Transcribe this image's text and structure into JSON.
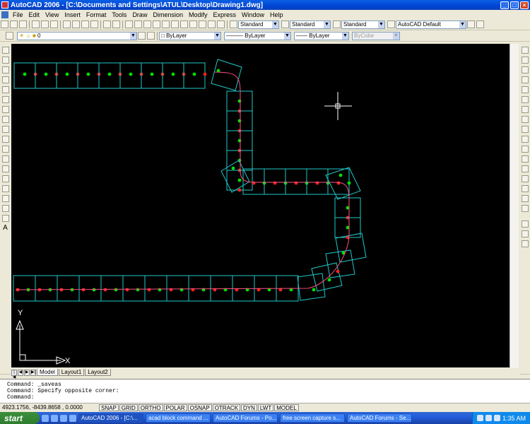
{
  "window": {
    "title": "AutoCAD 2006 - [C:\\Documents and Settings\\ATUL\\Desktop\\Drawing1.dwg]"
  },
  "menu": [
    "File",
    "Edit",
    "View",
    "Insert",
    "Format",
    "Tools",
    "Draw",
    "Dimension",
    "Modify",
    "Express",
    "Window",
    "Help"
  ],
  "toolbar": {
    "text_style": "Standard",
    "dim_style": "Standard",
    "table_style": "Standard",
    "plot_style": "AutoCAD Default",
    "layer": "0",
    "color": "ByLayer",
    "linetype": "ByLayer",
    "lineweight": "ByLayer",
    "plotstyle_control": "ByColor"
  },
  "ucs": {
    "y_label": "Y",
    "x_label": "X"
  },
  "layout_tabs": [
    "Model",
    "Layout1",
    "Layout2"
  ],
  "command_lines": [
    "Command: _saveas",
    "Command: Specify opposite corner:",
    "Command:"
  ],
  "status": {
    "coords": "4923.1756, -8439.8658 , 0.0000",
    "buttons": [
      "SNAP",
      "GRID",
      "ORTHO",
      "POLAR",
      "OSNAP",
      "OTRACK",
      "DYN",
      "LWT",
      "MODEL"
    ]
  },
  "taskbar": {
    "start": "start",
    "tasks": [
      "AutoCAD 2006 - [C:\\...",
      "acad block command ...",
      "AutoCAD Forums - Po...",
      "free screen capture s...",
      "AutoCAD Forums - Se..."
    ],
    "clock": "1:35 AM"
  },
  "colors": {
    "drawing_line": "#20c8c8",
    "green_point": "#00e000",
    "red_point": "#ff2020",
    "path_line": "#ff5080"
  }
}
